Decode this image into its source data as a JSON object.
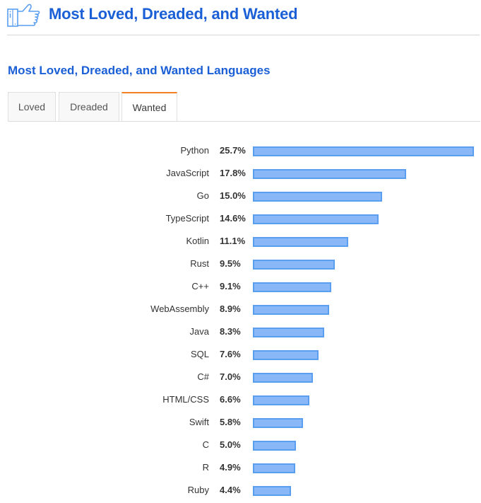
{
  "header": {
    "icon": "thumbs-up-icon",
    "title": "Most Loved, Dreaded, and Wanted"
  },
  "section": {
    "title": "Most Loved, Dreaded, and Wanted Languages"
  },
  "tabs": [
    {
      "label": "Loved",
      "active": false
    },
    {
      "label": "Dreaded",
      "active": false
    },
    {
      "label": "Wanted",
      "active": true
    }
  ],
  "colors": {
    "title": "#1a5fd6",
    "bar_fill": "#8ab7f8",
    "bar_border": "#5a9ef0",
    "active_tab_accent": "#f48024"
  },
  "chart_data": {
    "type": "bar",
    "orientation": "horizontal",
    "title": "Wanted",
    "xlabel": "",
    "ylabel": "",
    "unit": "%",
    "xlim": [
      0,
      25.7
    ],
    "grid": false,
    "legend": "none",
    "categories": [
      "Python",
      "JavaScript",
      "Go",
      "TypeScript",
      "Kotlin",
      "Rust",
      "C++",
      "WebAssembly",
      "Java",
      "SQL",
      "C#",
      "HTML/CSS",
      "Swift",
      "C",
      "R",
      "Ruby"
    ],
    "values": [
      25.7,
      17.8,
      15.0,
      14.6,
      11.1,
      9.5,
      9.1,
      8.9,
      8.3,
      7.6,
      7.0,
      6.6,
      5.8,
      5.0,
      4.9,
      4.4
    ],
    "value_labels": [
      "25.7%",
      "17.8%",
      "15.0%",
      "14.6%",
      "11.1%",
      "9.5%",
      "9.1%",
      "8.9%",
      "8.3%",
      "7.6%",
      "7.0%",
      "6.6%",
      "5.8%",
      "5.0%",
      "4.9%",
      "4.4%"
    ]
  }
}
